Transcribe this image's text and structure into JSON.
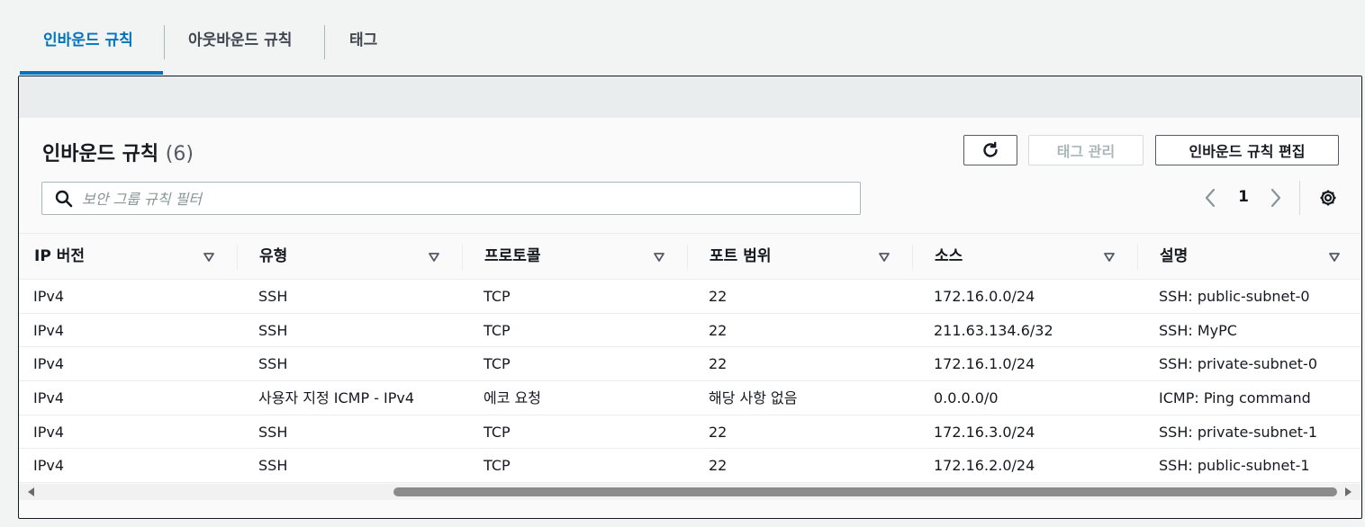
{
  "tabs": {
    "inbound": "인바운드 규칙",
    "outbound": "아웃바운드 규칙",
    "tags": "태그"
  },
  "panel": {
    "title": "인바운드 규칙",
    "count": "(6)",
    "buttons": {
      "refresh_icon": "refresh-icon",
      "manage_tags": "태그 관리",
      "edit_inbound": "인바운드 규칙 편집"
    },
    "search": {
      "placeholder": "보안 그룹 규칙 필터",
      "value": ""
    },
    "pagination": {
      "current_page": "1"
    }
  },
  "table": {
    "headers": [
      "IP 버전",
      "유형",
      "프로토콜",
      "포트 범위",
      "소스",
      "설명"
    ],
    "rows": [
      [
        "IPv4",
        "SSH",
        "TCP",
        "22",
        "172.16.0.0/24",
        "SSH: public-subnet-0"
      ],
      [
        "IPv4",
        "SSH",
        "TCP",
        "22",
        "211.63.134.6/32",
        "SSH: MyPC"
      ],
      [
        "IPv4",
        "SSH",
        "TCP",
        "22",
        "172.16.1.0/24",
        "SSH: private-subnet-0"
      ],
      [
        "IPv4",
        "사용자 지정 ICMP - IPv4",
        "에코 요청",
        "해당 사항 없음",
        "0.0.0.0/0",
        "ICMP: Ping command"
      ],
      [
        "IPv4",
        "SSH",
        "TCP",
        "22",
        "172.16.3.0/24",
        "SSH: private-subnet-1"
      ],
      [
        "IPv4",
        "SSH",
        "TCP",
        "22",
        "172.16.2.0/24",
        "SSH: public-subnet-1"
      ]
    ]
  },
  "colors": {
    "accent": "#0073bb",
    "text": "#16191f",
    "muted": "#545b64",
    "disabled": "#aab7b8"
  }
}
